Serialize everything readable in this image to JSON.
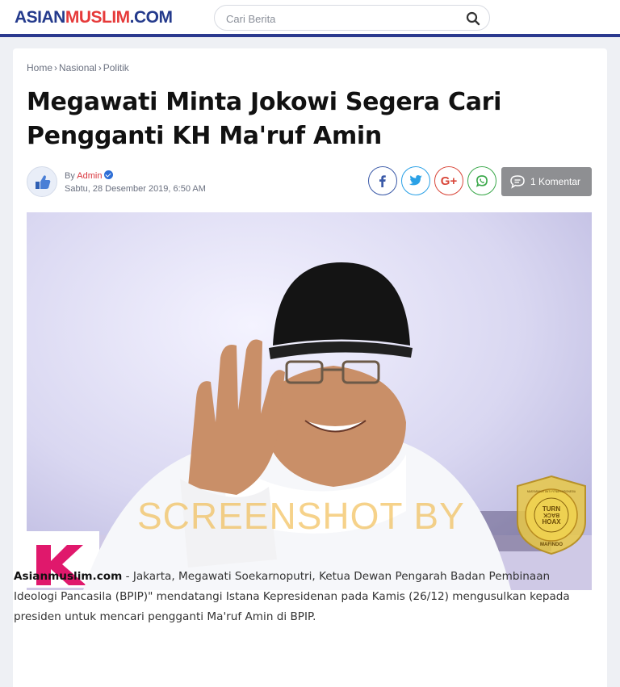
{
  "header": {
    "logo_part1": "ASIAN",
    "logo_part2": "MUSLIM",
    "logo_part3": ".COM",
    "search_placeholder": "Cari Berita",
    "brand_blue": "#243a8c",
    "brand_red": "#e63a3a"
  },
  "breadcrumb": {
    "items": [
      "Home",
      "Nasional",
      "Politik"
    ],
    "separator": "›"
  },
  "article": {
    "title": "Megawati Minta Jokowi Segera Cari Pengganti KH Ma'ruf Amin",
    "by_label": "By",
    "author": "Admin",
    "date": "Sabtu, 28 Desember 2019,  6:50 AM",
    "comments_label": "1 Komentar",
    "share_icons": [
      "facebook-icon",
      "twitter-icon",
      "google-plus-icon",
      "whatsapp-icon"
    ],
    "google_plus_text": "G+",
    "lead": "Asianmuslim.com",
    "body": " - Jakarta, Megawati Soekarnoputri, Ketua Dewan Pengarah Badan Pembinaan Ideologi Pancasila (BPIP)\" mendatangi Istana Kepresidenan pada Kamis (26/12) mengusulkan kepada presiden untuk mencari pengganti Ma'ruf Amin di BPIP."
  },
  "overlay": {
    "watermark": "SCREENSHOT BY",
    "badge_ring_text": "MASYARAKAT ANTI FITNAH INDONESIA",
    "badge_center_line1": "TURN",
    "badge_center_line2": "BACK",
    "badge_center_line3": "HOAX",
    "badge_bottom": "MAFINDO"
  }
}
